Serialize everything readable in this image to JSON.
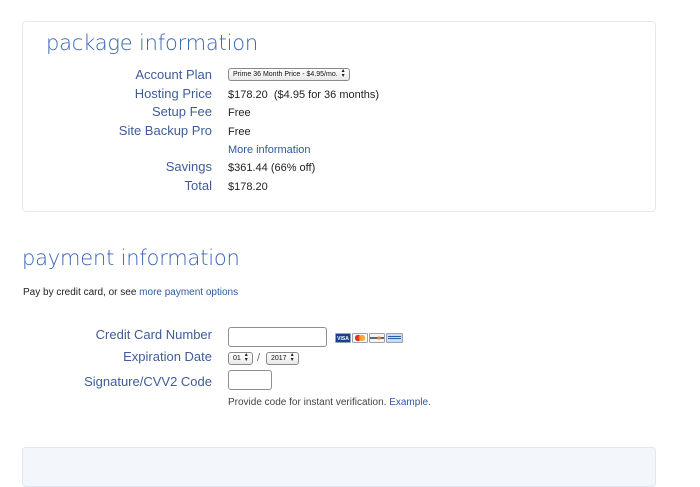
{
  "package": {
    "title": "package information",
    "account_plan": {
      "label": "Account Plan",
      "selected": "Prime 36 Month Price - $4.95/mo."
    },
    "hosting_price": {
      "label": "Hosting Price",
      "value": "$178.20",
      "note": "($4.95 for 36 months)"
    },
    "setup_fee": {
      "label": "Setup Fee",
      "value": "Free"
    },
    "site_backup": {
      "label": "Site Backup Pro",
      "value": "Free"
    },
    "more_info": "More information",
    "savings": {
      "label": "Savings",
      "value": "$361.44 (66% off)"
    },
    "total": {
      "label": "Total",
      "value": "$178.20"
    }
  },
  "payment": {
    "title": "payment information",
    "intro_text": "Pay by credit card, or see",
    "intro_link": "more payment options",
    "credit_card": {
      "label": "Credit Card Number",
      "value": ""
    },
    "card_logos": [
      "VISA",
      "MC",
      "DISCOVER",
      "AMEX"
    ],
    "expiration": {
      "label": "Expiration Date",
      "month": "01",
      "separator": "/",
      "year": "2017"
    },
    "cvv": {
      "label": "Signature/CVV2 Code",
      "value": ""
    },
    "cvv_help": "Provide code for instant verification.",
    "cvv_help_link": "Example."
  },
  "colors": {
    "heading": "#3a64b4",
    "label": "#3f5c99",
    "link": "#2f57a4",
    "card_border": "#e8e8e8"
  }
}
